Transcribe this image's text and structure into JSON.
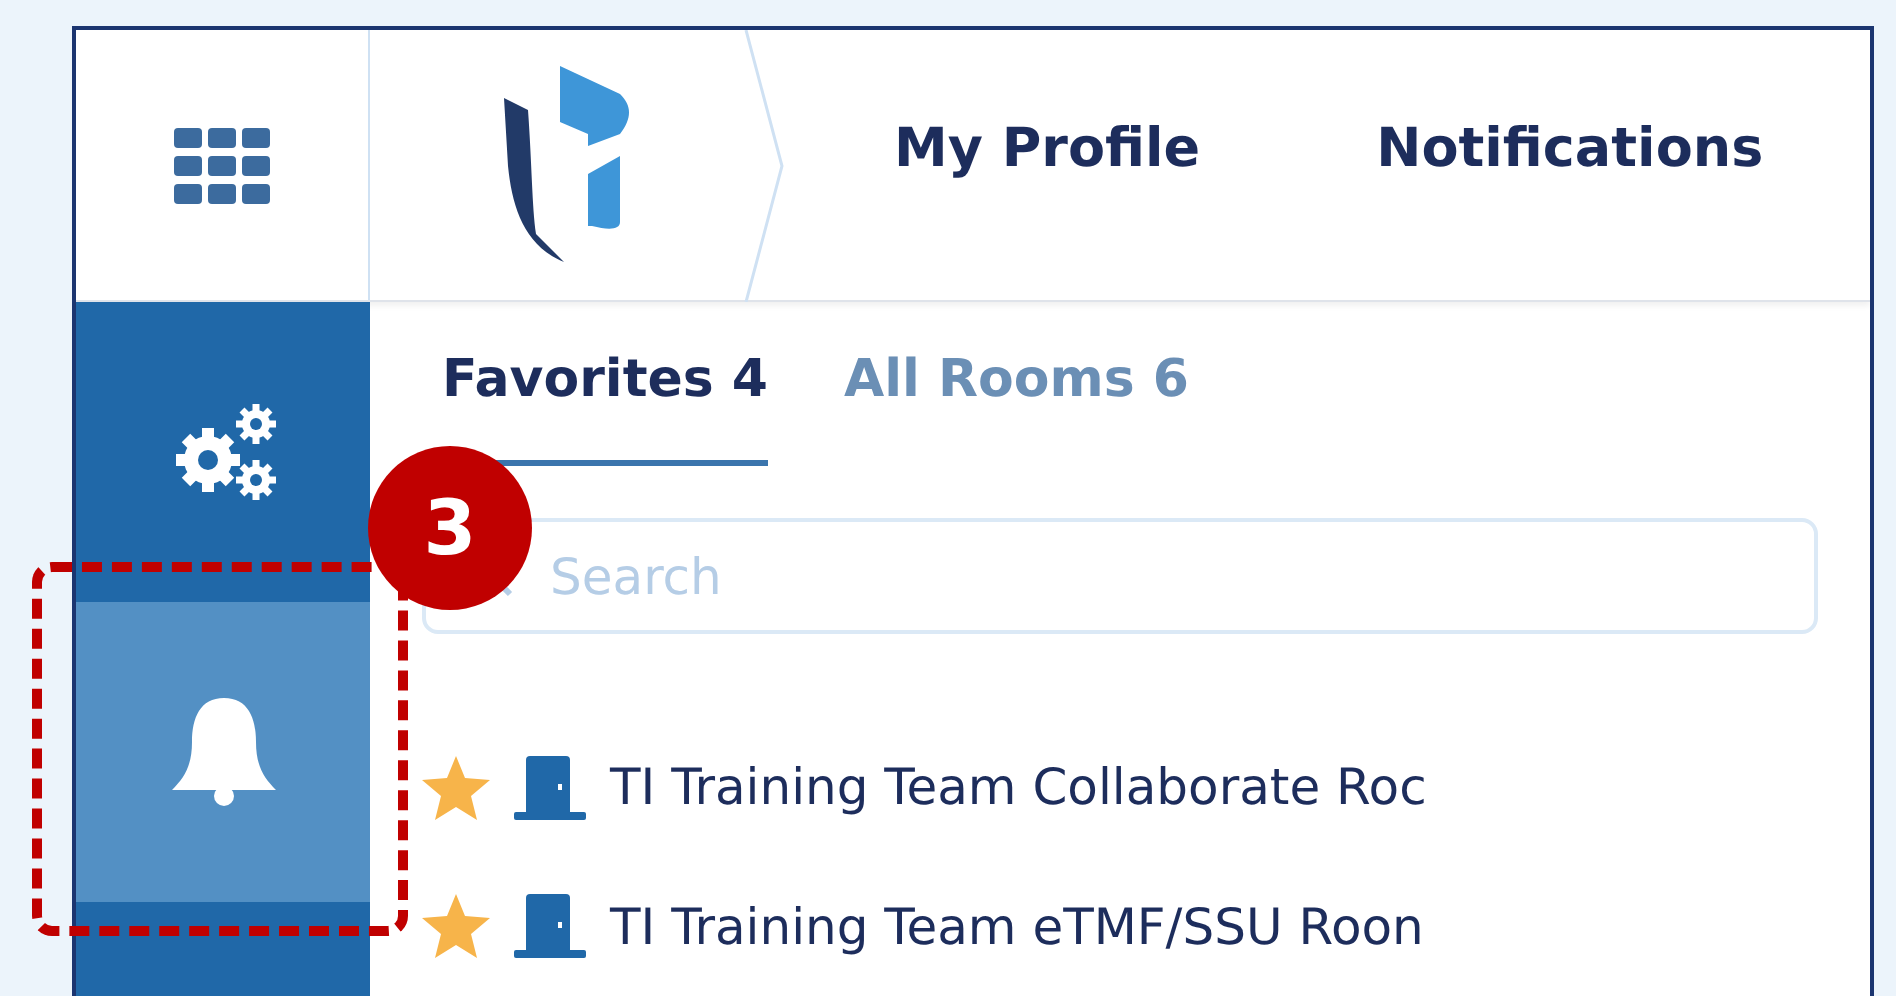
{
  "header": {
    "nav_links": [
      "My Profile",
      "Notifications"
    ]
  },
  "sidebar": {
    "items": [
      {
        "kind": "settings",
        "selected": false
      },
      {
        "kind": "notifications",
        "selected": true
      }
    ]
  },
  "tabs": [
    {
      "label": "Favorites 4",
      "selected": true
    },
    {
      "label": "All Rooms 6",
      "selected": false
    }
  ],
  "search": {
    "placeholder": "Search"
  },
  "rooms": [
    {
      "name": "TI Training Team Collaborate Roc",
      "favorite": true
    },
    {
      "name": "TI Training Team eTMF/SSU Roon",
      "favorite": true
    }
  ],
  "callout": {
    "number": "3"
  }
}
